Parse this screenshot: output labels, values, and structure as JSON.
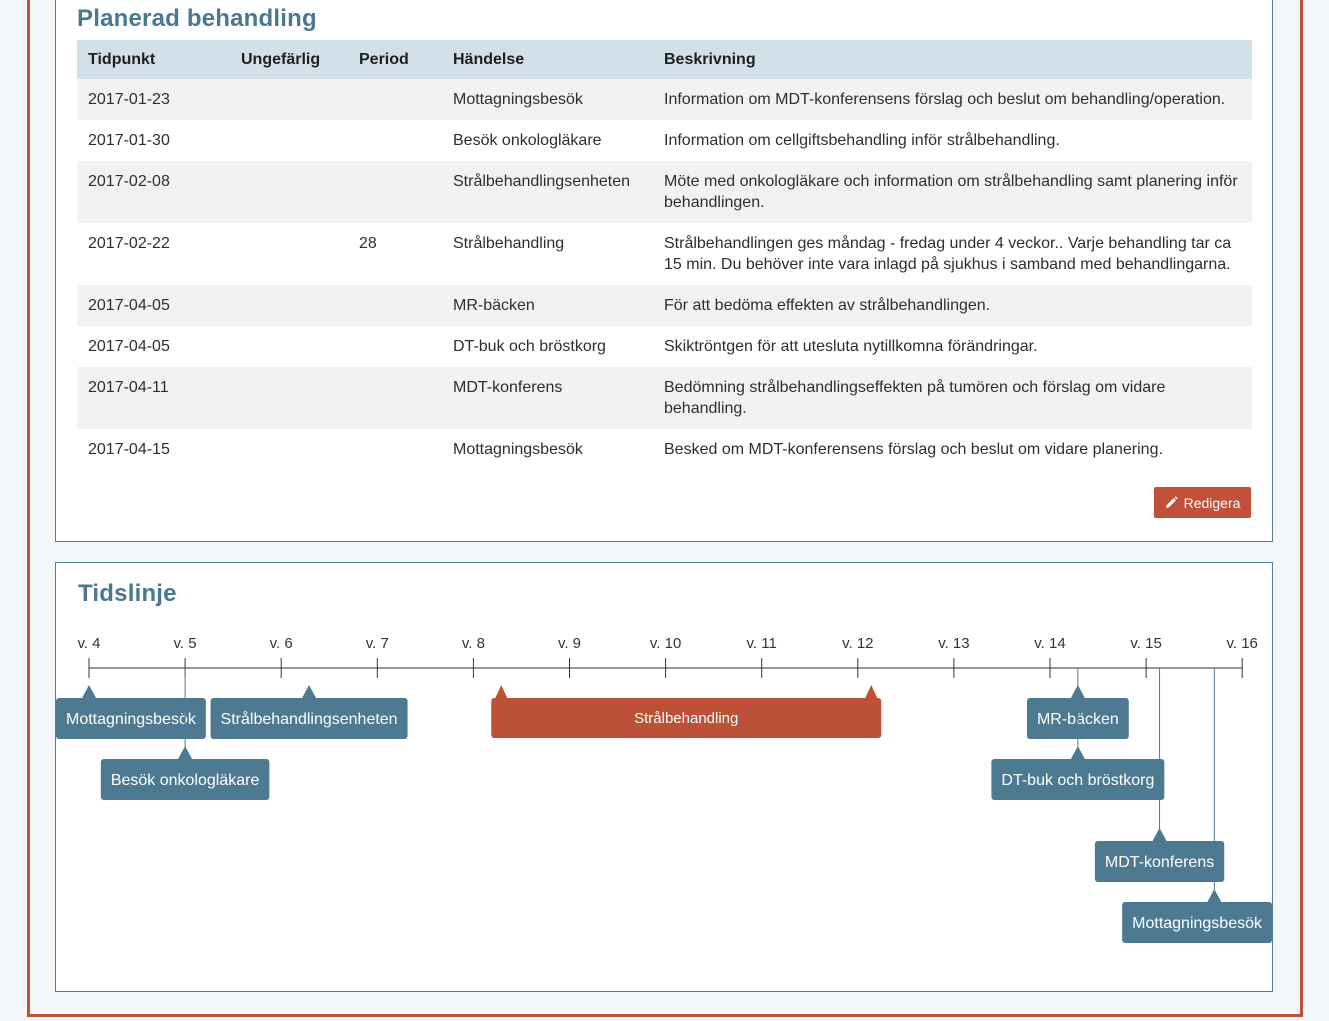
{
  "plan": {
    "title": "Planerad behandling",
    "headers": {
      "time": "Tidpunkt",
      "approx": "Ungefärlig",
      "period": "Period",
      "event": "Händelse",
      "description": "Beskrivning"
    },
    "rows": [
      {
        "time": "2017-01-23",
        "approx": "",
        "period": "",
        "event": "Mottagningsbesök",
        "description": "Information om MDT-konferensens förslag och beslut om behandling/operation."
      },
      {
        "time": "2017-01-30",
        "approx": "",
        "period": "",
        "event": "Besök onkologläkare",
        "description": "Information om cellgiftsbehandling inför strålbehandling."
      },
      {
        "time": "2017-02-08",
        "approx": "",
        "period": "",
        "event": "Strålbehandlingsenheten",
        "description": "Möte med onkologläkare och information om strålbehandling samt planering inför behandlingen."
      },
      {
        "time": "2017-02-22",
        "approx": "",
        "period": "28",
        "event": "Strålbehandling",
        "description": "Strålbehandlingen ges måndag - fredag under 4 veckor.. Varje behandling tar ca 15 min. Du behöver inte vara inlagd på sjukhus i samband med behandlingarna."
      },
      {
        "time": "2017-04-05",
        "approx": "",
        "period": "",
        "event": "MR-bäcken",
        "description": "För att bedöma effekten av strålbehandlingen."
      },
      {
        "time": "2017-04-05",
        "approx": "",
        "period": "",
        "event": "DT-buk och bröstkorg",
        "description": "Skiktröntgen för att utesluta nytillkomna förändringar."
      },
      {
        "time": "2017-04-11",
        "approx": "",
        "period": "",
        "event": "MDT-konferens",
        "description": "Bedömning strålbehandlingseffekten på tumören och förslag om vidare behandling."
      },
      {
        "time": "2017-04-15",
        "approx": "",
        "period": "",
        "event": "Mottagningsbesök",
        "description": "Besked om MDT-konferensens förslag och beslut om vidare planering."
      }
    ],
    "edit_label": "Redigera",
    "edit_icon": "pencil-icon"
  },
  "timeline": {
    "title": "Tidslinje",
    "weeks": [
      "v. 4",
      "v. 5",
      "v. 6",
      "v. 7",
      "v. 8",
      "v. 9",
      "v. 10",
      "v. 11",
      "v. 12",
      "v. 13",
      "v. 14",
      "v. 15",
      "v. 16"
    ],
    "first_week": 4,
    "events": [
      {
        "label": "Mottagningsbesök",
        "week": 4.0,
        "row": 0
      },
      {
        "label": "Besök onkologläkare",
        "week": 5.0,
        "row": 1
      },
      {
        "label": "Strålbehandlingsenheten",
        "week": 6.29,
        "row": 0
      },
      {
        "label": "MR-bäcken",
        "week": 14.29,
        "row": 0
      },
      {
        "label": "DT-buk och bröstkorg",
        "week": 14.29,
        "row": 1
      },
      {
        "label": "MDT-konferens",
        "week": 15.14,
        "row": 2
      },
      {
        "label": "Mottagningsbesök",
        "week": 15.71,
        "row": 3
      }
    ],
    "periods": [
      {
        "label": "Strålbehandling",
        "start_week": 8.29,
        "end_week": 12.14
      }
    ],
    "colors": {
      "event": "#4d7a91",
      "period": "#bd5137",
      "axis": "#333333"
    }
  }
}
